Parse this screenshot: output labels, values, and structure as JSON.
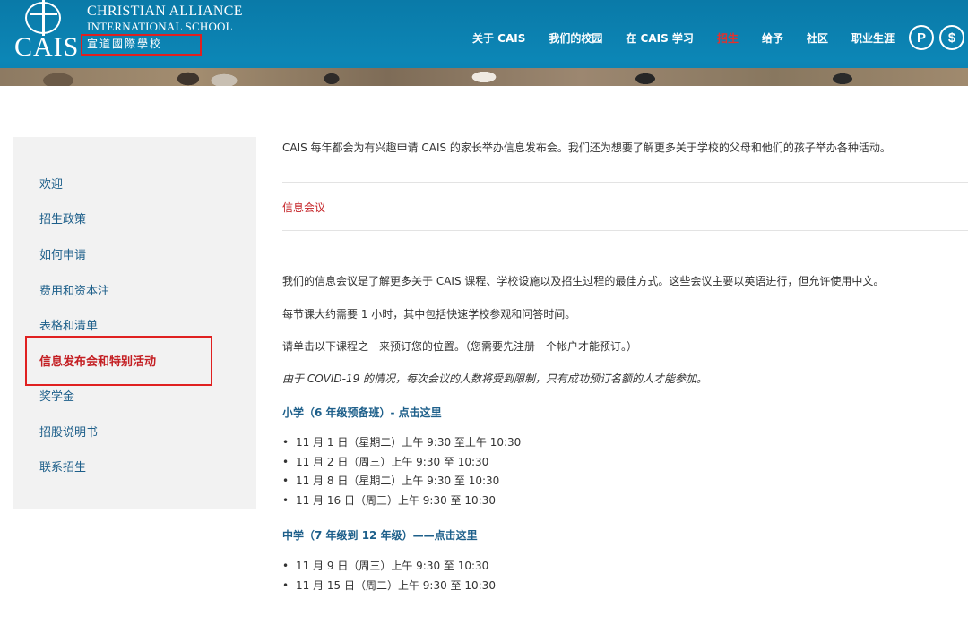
{
  "header": {
    "logo_text": "CAIS",
    "school_name_line1": "CHRISTIAN ALLIANCE",
    "school_name_line2": "INTERNATIONAL SCHOOL",
    "school_name_chinese": "宣道國際學校",
    "nav": [
      {
        "label": "关于 CAIS",
        "active": false
      },
      {
        "label": "我们的校园",
        "active": false
      },
      {
        "label": "在 CAIS 学习",
        "active": false
      },
      {
        "label": "招生",
        "active": true
      },
      {
        "label": "给予",
        "active": false
      },
      {
        "label": "社区",
        "active": false
      },
      {
        "label": "职业生涯",
        "active": false
      }
    ],
    "round_buttons": [
      "P",
      "$"
    ],
    "colors": {
      "header_bg": "#0c86b6",
      "active_nav": "#e4302c",
      "highlight_box": "#e02020"
    }
  },
  "sidebar": {
    "items": [
      {
        "label": "欢迎"
      },
      {
        "label": "招生政策"
      },
      {
        "label": "如何申请"
      },
      {
        "label": "费用和资本注"
      },
      {
        "label": "表格和清单"
      },
      {
        "label": "信息发布会和特别活动",
        "active": true
      },
      {
        "label": "奖学金"
      },
      {
        "label": "招股说明书"
      },
      {
        "label": "联系招生"
      }
    ]
  },
  "main": {
    "intro": "CAIS 每年都会为有兴趣申请 CAIS 的家长举办信息发布会。我们还为想要了解更多关于学校的父母和他们的孩子举办各种活动。",
    "section_title": "信息会议",
    "para1": "我们的信息会议是了解更多关于 CAIS 课程、学校设施以及招生过程的最佳方式。这些会议主要以英语进行，但允许使用中文。",
    "para2": "每节课大约需要 1 小时，其中包括快速学校参观和问答时间。",
    "para3": "请单击以下课程之一来预订您的位置。（您需要先注册一个帐户才能预订。）",
    "para4_italic": "由于 COVID-19 的情况，每次会议的人数将受到限制，只有成功预订名额的人才能参加。",
    "primary": {
      "heading": "小学（6 年级预备班）- 点击这里",
      "sessions": [
        "11 月 1 日（星期二）上午 9:30 至上午 10:30",
        "11 月 2 日（周三）上午 9:30 至 10:30",
        "11 月 8 日（星期二）上午 9:30 至 10:30",
        "11 月 16 日（周三）上午 9:30 至 10:30"
      ]
    },
    "secondary": {
      "heading": "中学（7 年级到 12 年级）——点击这里",
      "sessions": [
        "11 月 9 日（周三）上午 9:30 至 10:30",
        "11 月 15 日（周二）上午 9:30 至 10:30"
      ]
    }
  }
}
